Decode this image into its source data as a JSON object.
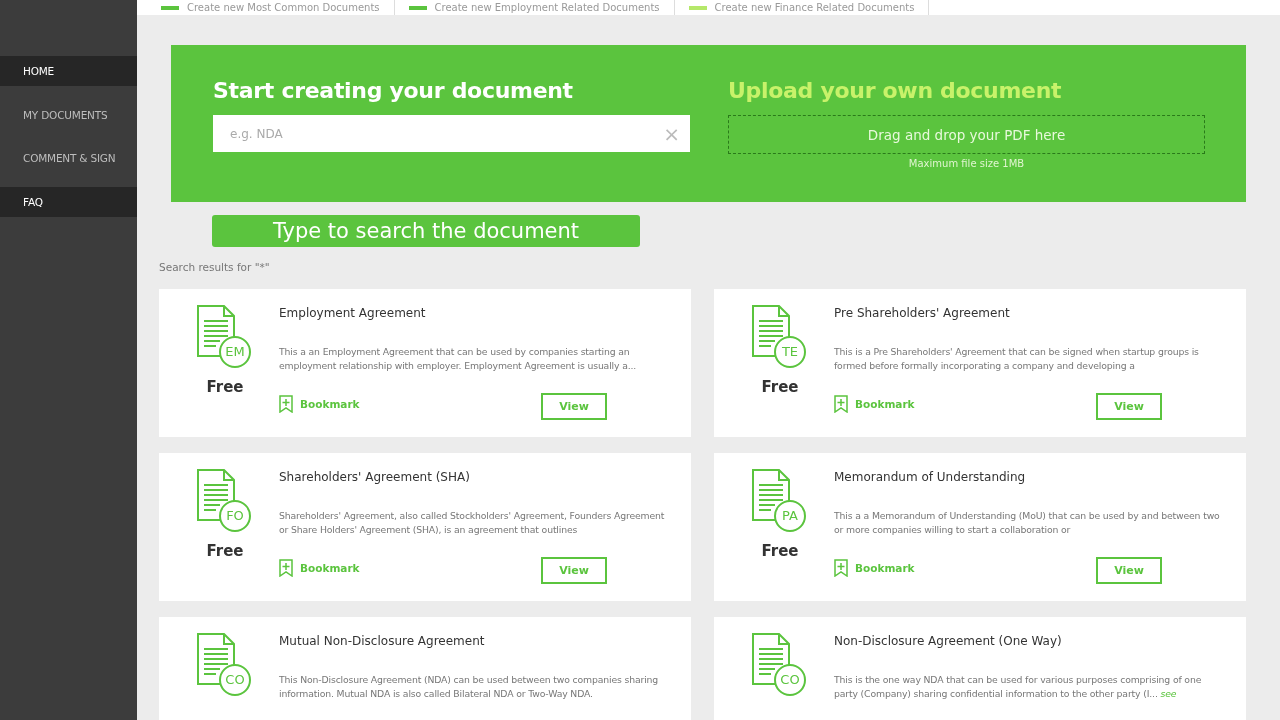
{
  "top_tabs": [
    {
      "label": "Create new Most Common Documents",
      "color": "#5bc43e"
    },
    {
      "label": "Create new Employment Related Documents",
      "color": "#5bc43e"
    },
    {
      "label": "Create new Finance Related Documents",
      "color": "#b5e86a"
    }
  ],
  "sidebar": {
    "items": [
      {
        "label": "HOME",
        "selected": true
      },
      {
        "label": "MY DOCUMENTS",
        "selected": false
      },
      {
        "label": "COMMENT & SIGN",
        "selected": false
      },
      {
        "label": "FAQ",
        "selected": true
      }
    ]
  },
  "create": {
    "title": "Start creating your document",
    "search": {
      "placeholder": "e.g. NDA",
      "clear": "×"
    }
  },
  "upload": {
    "title": "Upload your own document",
    "drop": "Drag and drop your PDF here",
    "note": "Maximum file size 1MB"
  },
  "search_button": "Type to search the document",
  "results_label": "Search results for \"*\"",
  "cards": [
    {
      "code": "EM",
      "title": "Employment Agreement",
      "description": "This a an Employment Agreement  that can be used by  companies starting  an employment relationship with employer.  Employment Agreement is usually a...",
      "price": "Free",
      "bookmark": "Bookmark",
      "view": "View"
    },
    {
      "code": "TE",
      "title": "Pre Shareholders' Agreement",
      "description": "This is a Pre Shareholders' Agreement that can be signed when startup groups  is formed before formally incorporating a company and developing a",
      "price": "Free",
      "bookmark": "Bookmark",
      "view": "View"
    },
    {
      "code": "FO",
      "title": "Shareholders' Agreement (SHA)",
      "description": "Shareholders' Agreement, also called Stockholders' Agreement, Founders Agreement or Share Holders' Agreement (SHA), is an agreement that outlines",
      "price": "Free",
      "bookmark": "Bookmark",
      "view": "View"
    },
    {
      "code": "PA",
      "title": "Memorandum of Understanding",
      "description": "This a a Memorandum of Understanding (MoU) that can be used by and between two or more companies willing to start a collaboration or",
      "price": "Free",
      "bookmark": "Bookmark",
      "view": "View"
    },
    {
      "code": "CO",
      "title": "Mutual Non-Disclosure Agreement",
      "description": "This Non-Disclosure Agreement (NDA) can be used between two companies sharing information. Mutual NDA is also called Bilateral NDA or Two-Way NDA."
    },
    {
      "code": "CO",
      "title": "Non-Disclosure Agreement (One Way)",
      "description": "This is the one way NDA that can be used for various purposes comprising of one party (Company) sharing confidential information to the other party (I...",
      "more": "see"
    }
  ]
}
